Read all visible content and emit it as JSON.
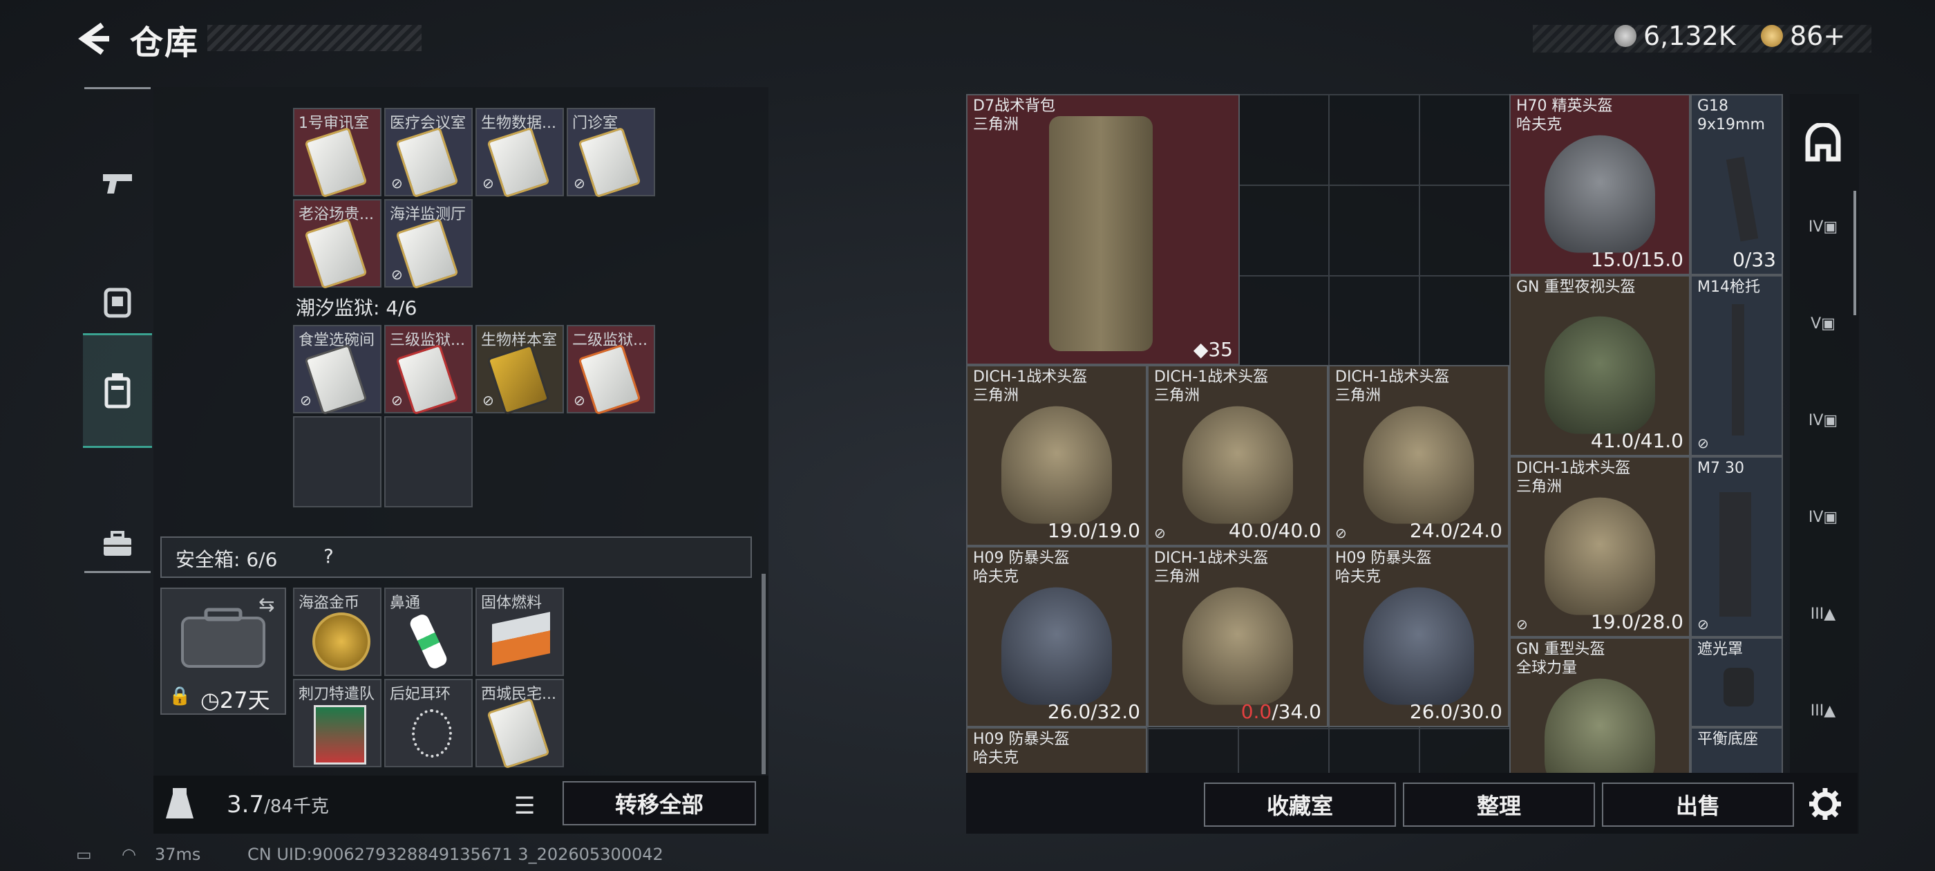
{
  "header": {
    "title": "仓库",
    "currency1": "6,132K",
    "currency2": "86+"
  },
  "left_tabs": [
    {
      "name": "weapons"
    },
    {
      "name": "equipment"
    },
    {
      "name": "storage"
    },
    {
      "name": "tools"
    }
  ],
  "keys_top": {
    "row1": [
      "1号审讯室",
      "医疗会议室",
      "生物数据...",
      "门诊室"
    ],
    "row2": [
      "老浴场贵...",
      "海洋监测厅"
    ]
  },
  "prison": {
    "title": "潮汐监狱: 4/6",
    "items": [
      "食堂选碗间",
      "三级监狱...",
      "生物样本室",
      "二级监狱..."
    ]
  },
  "safe": {
    "title": "安全箱: 6/6",
    "help": "?",
    "days": "27天",
    "items": [
      "海盗金币",
      "鼻通",
      "固体燃料",
      "刺刀特遣队",
      "后妃耳环",
      "西城民宅..."
    ]
  },
  "weight": {
    "value": "3.7",
    "unit": "/84千克"
  },
  "transfer_all": "转移全部",
  "stash": {
    "backpack": {
      "name": "D7战术背包",
      "sub": "三角洲",
      "count": "35"
    },
    "h70": {
      "name": "H70 精英头盔",
      "sub": "哈夫克",
      "dur": "15.0/15.0"
    },
    "g18": {
      "name": "G18",
      "sub": "9x19mm",
      "dur": "0/33"
    },
    "gn1": {
      "name": "GN 重型夜视头盔",
      "sub": "",
      "dur": "41.0/41.0"
    },
    "m14": {
      "name": "M14枪托",
      "sub": ""
    },
    "dich1": {
      "name": "DICH-1战术头盔",
      "sub": "三角洲",
      "dur": "19.0/19.0"
    },
    "dich2": {
      "name": "DICH-1战术头盔",
      "sub": "三角洲",
      "dur": "40.0/40.0"
    },
    "dich3": {
      "name": "DICH-1战术头盔",
      "sub": "三角洲",
      "dur": "24.0/24.0"
    },
    "dich4": {
      "name": "DICH-1战术头盔",
      "sub": "三角洲",
      "dur": "19.0/28.0"
    },
    "m7": {
      "name": "M7 30",
      "sub": ""
    },
    "h09a": {
      "name": "H09 防暴头盔",
      "sub": "哈夫克",
      "dur": "26.0/32.0"
    },
    "dich5": {
      "name": "DICH-1战术头盔",
      "sub": "三角洲",
      "dur_low": "0.0",
      "dur_rest": "/34.0"
    },
    "h09b": {
      "name": "H09 防暴头盔",
      "sub": "哈夫克",
      "dur": "26.0/30.0"
    },
    "gn2": {
      "name": "GN 重型头盔",
      "sub": "全球力量"
    },
    "shade": {
      "name": "遮光罩",
      "sub": ""
    },
    "h09c": {
      "name": "H09 防暴头盔",
      "sub": "哈夫克"
    },
    "base": {
      "name": "平衡底座",
      "sub": ""
    }
  },
  "buttons": {
    "collection": "收藏室",
    "sort": "整理",
    "sell": "出售"
  },
  "status": {
    "ping": "37ms",
    "uid": "CN UID:9006279328849135671 3_202605300042"
  },
  "colors": {
    "accent": "#3aa391",
    "red_cell": "#4e2329",
    "low_dur": "#e34040"
  }
}
